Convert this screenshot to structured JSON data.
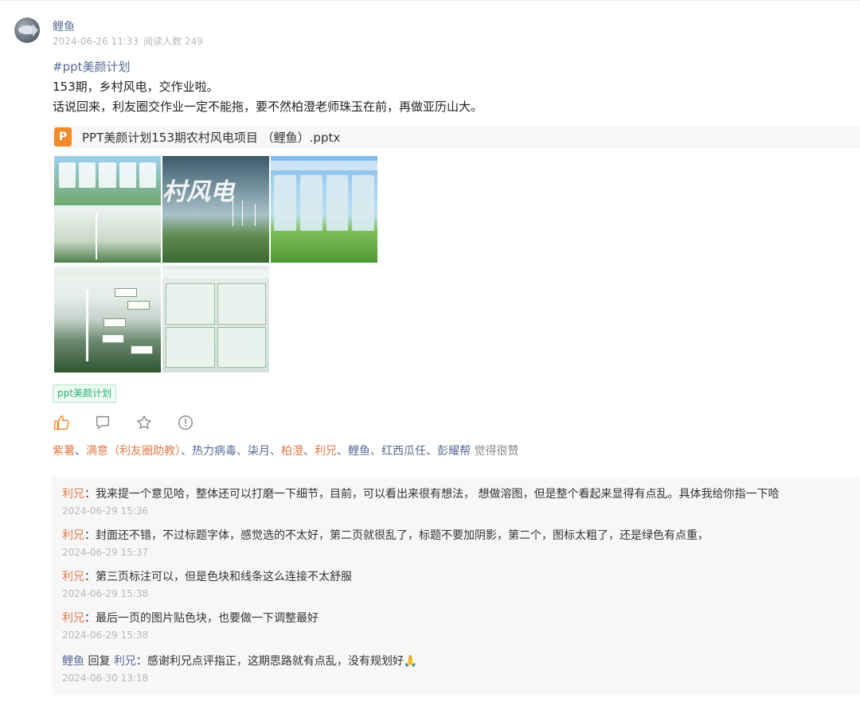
{
  "post": {
    "author": "鲤鱼",
    "date": "2024-06-26 11:33",
    "reads": "阅读人数 249",
    "hashtag": "#ppt美颜计划",
    "line1": "153期，乡村风电，交作业啦。",
    "line2": "话说回来，利友圈交作业一定不能拖，要不然柏澄老师珠玉在前，再做亚历山大。",
    "attachment": {
      "icon_letter": "P",
      "name": "PPT美颜计划153期农村风电项目 （鲤鱼）.pptx"
    },
    "thumbnail_texts": {
      "cover_title": "村风电"
    },
    "tag": "ppt美颜计划"
  },
  "actions": [
    "like-icon",
    "comment-icon",
    "star-icon",
    "report-icon"
  ],
  "likes": {
    "names": [
      {
        "text": "紫薯",
        "accent": true
      },
      {
        "text": "满意（利友圈助教）",
        "accent": true
      },
      {
        "text": "热力病毒",
        "accent": false
      },
      {
        "text": "柒月",
        "accent": false
      },
      {
        "text": "柏澄",
        "accent": true
      },
      {
        "text": "利兄",
        "accent": true
      },
      {
        "text": "鲤鱼",
        "accent": false
      },
      {
        "text": "红西瓜任",
        "accent": false
      },
      {
        "text": "彭耀帮",
        "accent": false
      }
    ],
    "separator": "、",
    "suffix": "觉得很赞"
  },
  "comments": [
    {
      "author": "利兄",
      "text": "我来提一个意见哈，整体还可以打磨一下细节，目前，可以看出来很有想法， 想做溶图，但是整个看起来显得有点乱。具体我给你指一下哈",
      "time": "2024-06-29 15:36"
    },
    {
      "author": "利兄",
      "text": "封面还不错，不过标题字体，感觉选的不太好，第二页就很乱了，标题不要加阴影，第二个，图标太粗了，还是绿色有点重，",
      "time": "2024-06-29 15:37"
    },
    {
      "author": "利兄",
      "text": "第三页标注可以，但是色块和线条这么连接不太舒服",
      "time": "2024-06-29 15:38"
    },
    {
      "author": "利兄",
      "text": "最后一页的图片贴色块，也要做一下调整最好",
      "time": "2024-06-29 15:38"
    },
    {
      "author": "鲤鱼",
      "reply_word": "回复",
      "reply_to": "利兄",
      "text": "感谢利兄点评指正，这期思路就有点乱，没有规划好🙏",
      "time": "2024-06-30 13:18"
    }
  ],
  "colors": {
    "link": "#576b95",
    "accent_name": "#e07b4a",
    "tag_green": "#2db277",
    "ppt_orange": "#f08a2b",
    "icon_like": "#f08a2b",
    "icon_gray": "#8c8c8c"
  }
}
